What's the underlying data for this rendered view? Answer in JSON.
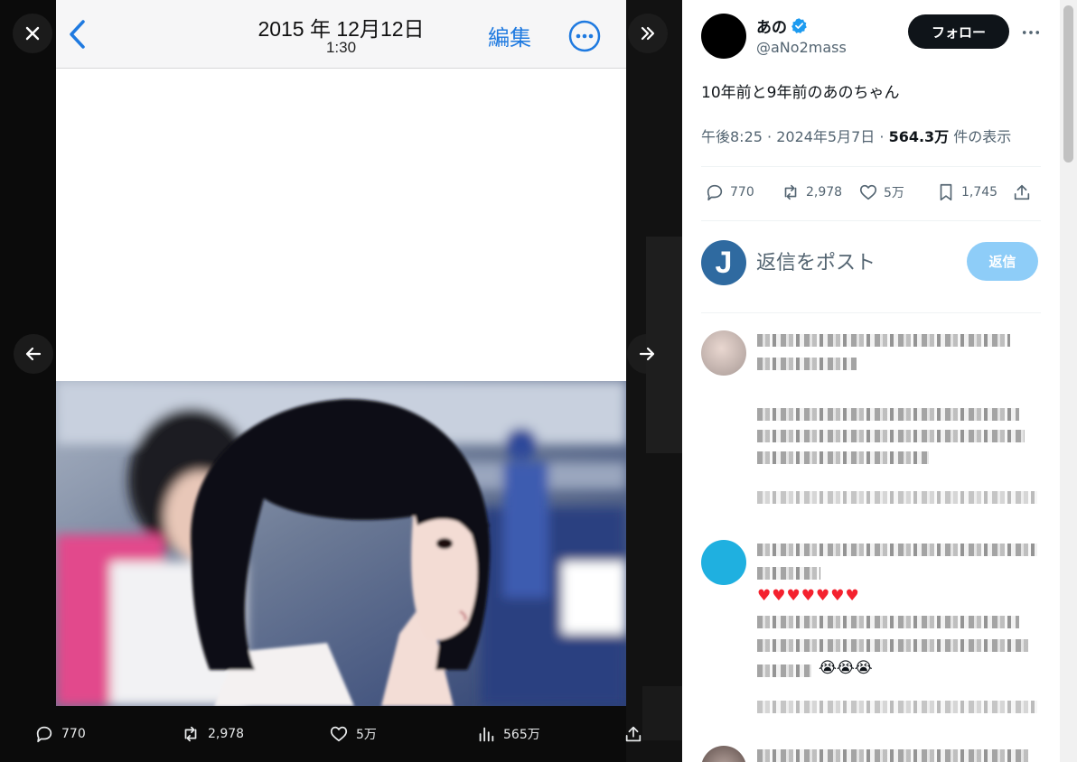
{
  "viewer": {
    "photo_header": {
      "date": "2015 年 12月12日",
      "time": "1:30",
      "edit_label": "編集"
    },
    "actions": {
      "replies": "770",
      "reposts": "2,978",
      "likes": "5万",
      "views": "565万"
    }
  },
  "tweet": {
    "author_name": "あの",
    "author_handle": "@aNo2mass",
    "follow_label": "フォロー",
    "text": "10年前と9年前のあのちゃん",
    "time": "午後8:25",
    "date": "2024年5月7日",
    "views_count": "564.3万",
    "views_suffix": "件の表示",
    "actions": {
      "replies": "770",
      "reposts": "2,978",
      "likes": "5万",
      "bookmarks": "1,745"
    }
  },
  "composer": {
    "avatar_letter": "J",
    "placeholder": "返信をポスト",
    "reply_label": "返信"
  },
  "colors": {
    "accent": "#1d9bf0",
    "reply_button": "#8ecdf8",
    "follow_button": "#0f1419",
    "ios_blue": "#1f7ae0"
  },
  "icons": [
    "close-icon",
    "chevron-double-right-icon",
    "arrow-left-icon",
    "arrow-right-icon",
    "ios-back-chevron-icon",
    "ellipsis-circle-icon",
    "reply-icon",
    "repost-icon",
    "like-icon",
    "views-icon",
    "share-icon",
    "bookmark-icon",
    "verified-badge-icon",
    "more-icon"
  ]
}
